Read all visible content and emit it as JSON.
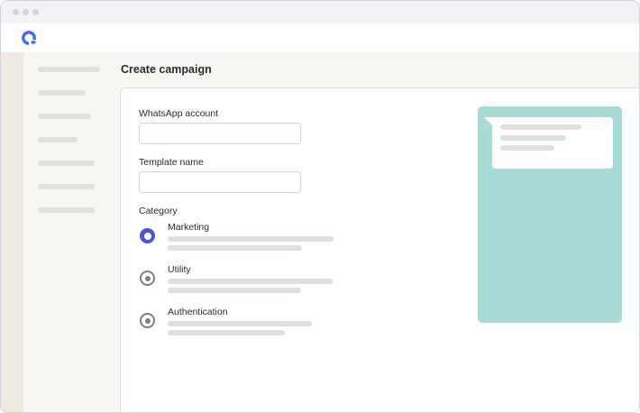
{
  "page": {
    "title": "Create campaign"
  },
  "form": {
    "whatsapp_account_label": "WhatsApp account",
    "whatsapp_account_value": "",
    "template_name_label": "Template name",
    "template_name_value": "",
    "category_label": "Category",
    "category_options": [
      {
        "label": "Marketing",
        "selected": true
      },
      {
        "label": "Utility",
        "selected": false
      },
      {
        "label": "Authentication",
        "selected": false
      }
    ]
  },
  "icons": {
    "logo": "app-logo-icon"
  },
  "colors": {
    "accent": "#4a55d8",
    "preview_background": "#a8dbd5",
    "sidebar_rail": "#efe9e1",
    "radio_unselected": "#7a7e88"
  }
}
